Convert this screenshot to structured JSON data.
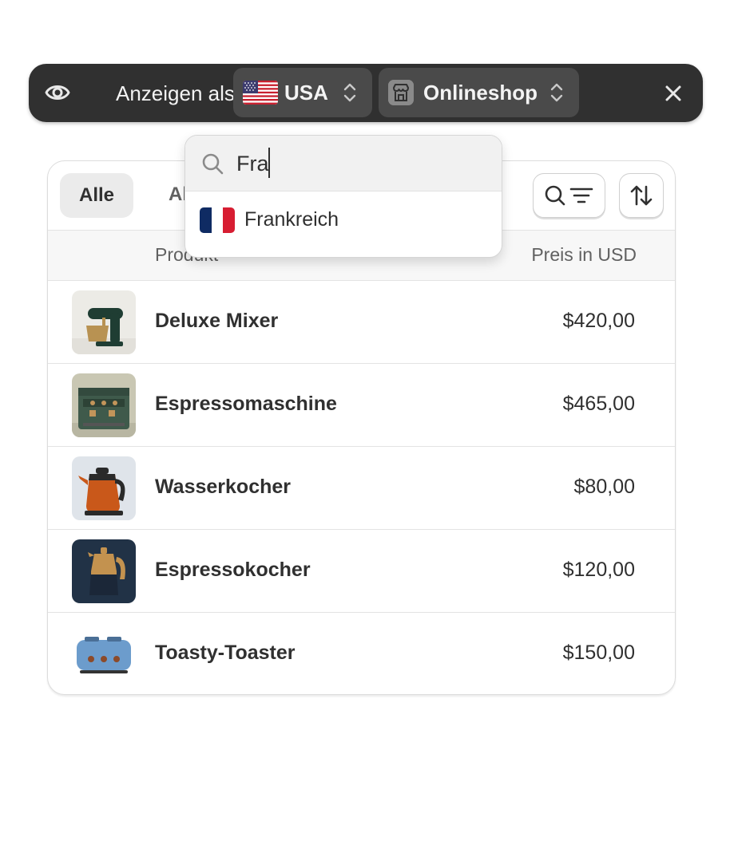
{
  "viewbar": {
    "label": "Anzeigen als",
    "country": "USA",
    "channel": "Onlineshop"
  },
  "tabs": {
    "all": "Alle",
    "second_partial": "Al"
  },
  "table": {
    "col_product": "Produkt",
    "col_price": "Preis in USD",
    "rows": [
      {
        "name": "Deluxe Mixer",
        "price": "$420,00",
        "thumb_icon": "mixer-image"
      },
      {
        "name": "Espressomaschine",
        "price": "$465,00",
        "thumb_icon": "espresso-machine-image"
      },
      {
        "name": "Wasserkocher",
        "price": "$80,00",
        "thumb_icon": "kettle-image"
      },
      {
        "name": "Espressokocher",
        "price": "$120,00",
        "thumb_icon": "moka-pot-image"
      },
      {
        "name": "Toasty-Toaster",
        "price": "$150,00",
        "thumb_icon": "toaster-image"
      }
    ]
  },
  "popover": {
    "search_value": "Fra",
    "options": [
      {
        "label": "Frankreich",
        "flag": "flag-france-icon"
      }
    ]
  },
  "colors": {
    "bar_bg": "#303030",
    "chip_bg": "#4a4a4a",
    "text": "#303030",
    "muted": "#616161"
  }
}
